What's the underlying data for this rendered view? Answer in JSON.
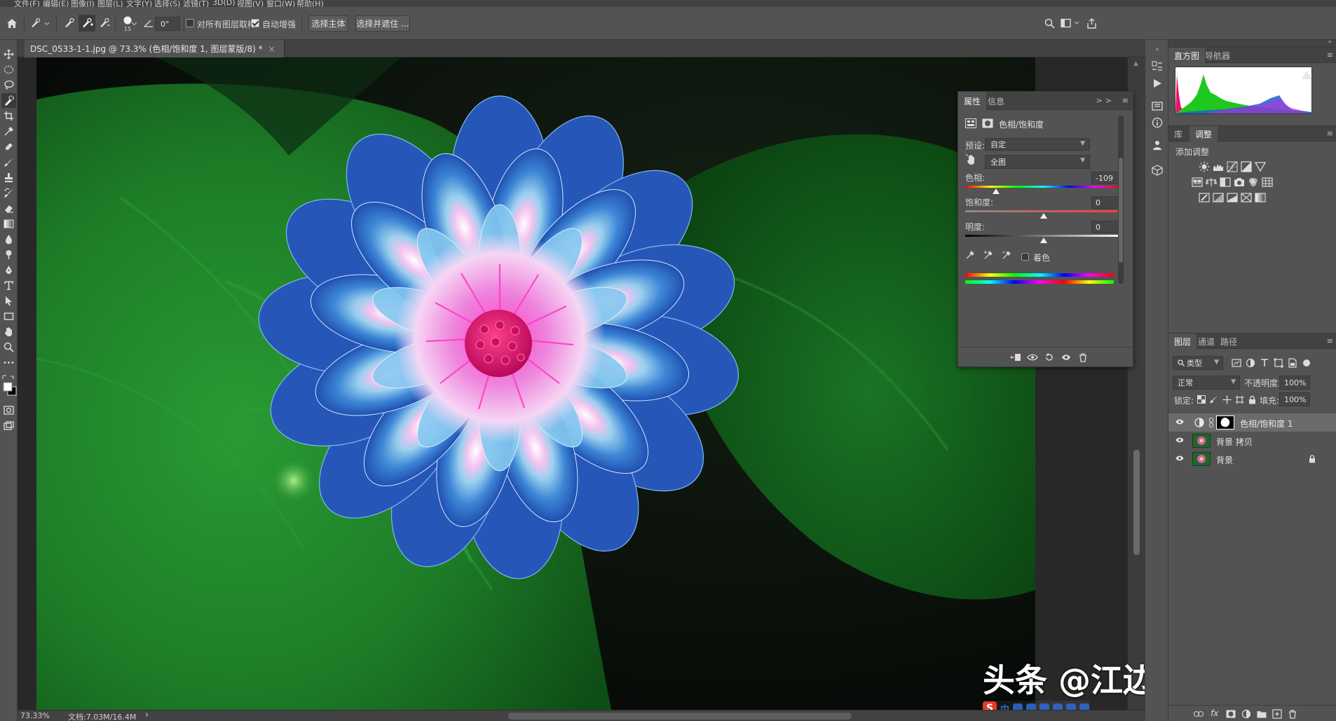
{
  "app": {
    "name": "Adobe Photoshop"
  },
  "menu": [
    "文件(F)",
    "编辑(E)",
    "图像(I)",
    "图层(L)",
    "文字(Y)",
    "选择(S)",
    "滤镜(T)",
    "3D(D)",
    "视图(V)",
    "窗口(W)",
    "帮助(H)"
  ],
  "options_bar": {
    "brush_size": "15",
    "angle": "0°",
    "sample_all_layers_label": "对所有图层取样",
    "sample_all_layers": false,
    "auto_enhance_label": "自动增强",
    "auto_enhance": true,
    "select_subject": "选择主体",
    "select_and_mask": "选择并遮住 ..."
  },
  "document": {
    "tab_title": "DSC_0533-1-1.jpg @ 73.3% (色相/饱和度 1, 图层蒙版/8) *",
    "close_glyph": "×"
  },
  "status": {
    "zoom": "73.33%",
    "doc_size": "文档:7.03M/16.4M",
    "arrow": "›"
  },
  "watermark": {
    "text": "头条 @江边鸟HONG"
  },
  "ime": {
    "logo": "S",
    "label": "中"
  },
  "properties_panel": {
    "tabs": [
      "属性",
      "信息"
    ],
    "collapse_glyph": ">>",
    "menu_glyph": "≡",
    "title": "色相/饱和度",
    "preset_label": "预设:",
    "preset_value": "自定",
    "channel_value": "全图",
    "hue_label": "色相:",
    "hue_value": "-109",
    "hue": -109,
    "saturation_label": "饱和度:",
    "saturation_value": "0",
    "saturation": 0,
    "lightness_label": "明度:",
    "lightness_value": "0",
    "lightness": 0,
    "colorize_label": "着色",
    "colorize": false
  },
  "histogram_panel": {
    "tabs": [
      "直方图",
      "导航器"
    ],
    "menu_glyph": "≡"
  },
  "adjustments_panel": {
    "tabs": [
      "库",
      "调整"
    ],
    "add_label": "添加调整",
    "menu_glyph": "≡"
  },
  "layers_panel": {
    "tabs": [
      "图层",
      "通道",
      "路径"
    ],
    "menu_glyph": "≡",
    "filter_kind": "类型",
    "blend_mode": "正常",
    "opacity_label": "不透明度:",
    "opacity": "100%",
    "lock_label": "锁定:",
    "fill_label": "填充:",
    "fill": "100%",
    "fx_label": "fx",
    "layers": [
      {
        "name": "色相/饱和度 1",
        "kind": "adjustment",
        "visible": true,
        "selected": true
      },
      {
        "name": "背景 拷贝",
        "kind": "image",
        "visible": true,
        "selected": false
      },
      {
        "name": "背景",
        "kind": "image",
        "visible": true,
        "selected": false,
        "locked": true
      }
    ]
  },
  "colors": {
    "ui_panel": "#535353",
    "ui_dark": "#424242",
    "canvas_bg": "#282828",
    "leaf_green": "#1a7a26",
    "petal_blue": "#2f6fc8",
    "center_magenta": "#e0137c"
  }
}
